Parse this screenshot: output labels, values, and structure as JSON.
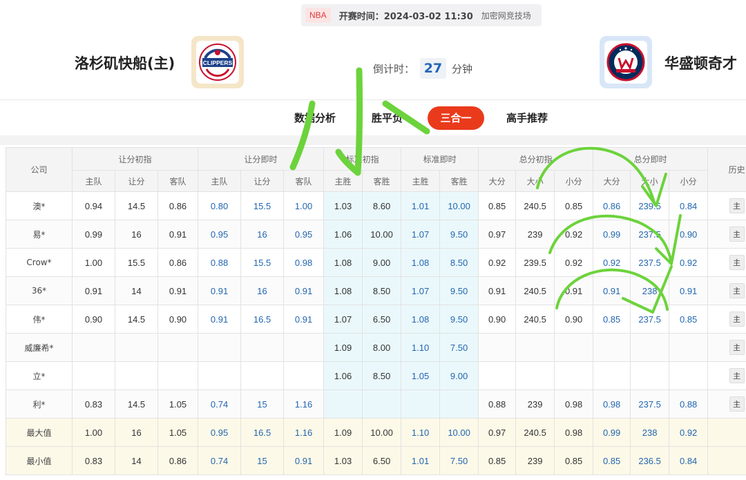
{
  "header": {
    "league": "NBA",
    "start_time": "开赛时间：2024-03-02 11:30",
    "venue": "加密网竞技场",
    "home_team": "洛杉矶快船(主)",
    "away_team": "华盛顿奇才",
    "home_logo_text": "CLIPPERS",
    "countdown_label": "倒计时：",
    "countdown_value": "27",
    "countdown_unit": "分钟"
  },
  "tabs": {
    "data": "数据分析",
    "spf": "胜平负",
    "three": "三合一",
    "expert": "高手推荐"
  },
  "table": {
    "company_header": "公司",
    "history_header": "历史",
    "groups": {
      "rf_init": "让分初指",
      "rf_live": "让分即时",
      "std_init": "标准初指",
      "std_live": "标准即时",
      "tot_init": "总分初指",
      "tot_live": "总分即时"
    },
    "sub": {
      "home": "主队",
      "handicap": "让分",
      "away": "客队",
      "home_win": "主胜",
      "away_win": "客胜",
      "over": "大分",
      "line": "大小",
      "under": "小分"
    },
    "history_btn": "主",
    "rows": [
      {
        "company": "澳*",
        "rf_init": [
          "0.94",
          "14.5",
          "0.86"
        ],
        "rf_live": [
          "0.80",
          "15.5",
          "1.00"
        ],
        "std_init": [
          "1.03",
          "8.60"
        ],
        "std_live": [
          "1.01",
          "10.00"
        ],
        "tot_init": [
          "0.85",
          "240.5",
          "0.85"
        ],
        "tot_live": [
          "0.86",
          "239.5",
          "0.84"
        ]
      },
      {
        "company": "易*",
        "rf_init": [
          "0.99",
          "16",
          "0.91"
        ],
        "rf_live": [
          "0.95",
          "16",
          "0.95"
        ],
        "std_init": [
          "1.06",
          "10.00"
        ],
        "std_live": [
          "1.07",
          "9.50"
        ],
        "tot_init": [
          "0.97",
          "239",
          "0.92"
        ],
        "tot_live": [
          "0.99",
          "237.5",
          "0.90"
        ]
      },
      {
        "company": "Crow*",
        "rf_init": [
          "1.00",
          "15.5",
          "0.86"
        ],
        "rf_live": [
          "0.88",
          "15.5",
          "0.98"
        ],
        "std_init": [
          "1.08",
          "9.00"
        ],
        "std_live": [
          "1.08",
          "8.50"
        ],
        "tot_init": [
          "0.92",
          "239.5",
          "0.92"
        ],
        "tot_live": [
          "0.92",
          "237.5",
          "0.92"
        ]
      },
      {
        "company": "36*",
        "rf_init": [
          "0.91",
          "14",
          "0.91"
        ],
        "rf_live": [
          "0.91",
          "16",
          "0.91"
        ],
        "std_init": [
          "1.08",
          "8.50"
        ],
        "std_live": [
          "1.07",
          "9.50"
        ],
        "tot_init": [
          "0.91",
          "240.5",
          "0.91"
        ],
        "tot_live": [
          "0.91",
          "238",
          "0.91"
        ]
      },
      {
        "company": "伟*",
        "rf_init": [
          "0.90",
          "14.5",
          "0.90"
        ],
        "rf_live": [
          "0.91",
          "16.5",
          "0.91"
        ],
        "std_init": [
          "1.07",
          "6.50"
        ],
        "std_live": [
          "1.08",
          "9.50"
        ],
        "tot_init": [
          "0.90",
          "240.5",
          "0.90"
        ],
        "tot_live": [
          "0.85",
          "237.5",
          "0.85"
        ]
      },
      {
        "company": "威廉希*",
        "rf_init": [
          "",
          "",
          ""
        ],
        "rf_live": [
          "",
          "",
          ""
        ],
        "std_init": [
          "1.09",
          "8.00"
        ],
        "std_live": [
          "1.10",
          "7.50"
        ],
        "tot_init": [
          "",
          "",
          ""
        ],
        "tot_live": [
          "",
          "",
          ""
        ]
      },
      {
        "company": "立*",
        "rf_init": [
          "",
          "",
          ""
        ],
        "rf_live": [
          "",
          "",
          ""
        ],
        "std_init": [
          "1.06",
          "8.50"
        ],
        "std_live": [
          "1.05",
          "9.00"
        ],
        "tot_init": [
          "",
          "",
          ""
        ],
        "tot_live": [
          "",
          "",
          ""
        ]
      },
      {
        "company": "利*",
        "rf_init": [
          "0.83",
          "14.5",
          "1.05"
        ],
        "rf_live": [
          "0.74",
          "15",
          "1.16"
        ],
        "std_init": [
          "",
          ""
        ],
        "std_live": [
          "",
          ""
        ],
        "tot_init": [
          "0.88",
          "239",
          "0.98"
        ],
        "tot_live": [
          "0.98",
          "237.5",
          "0.88"
        ]
      }
    ],
    "stats": [
      {
        "label": "最大值",
        "rf_init": [
          "1.00",
          "16",
          "1.05"
        ],
        "rf_live": [
          "0.95",
          "16.5",
          "1.16"
        ],
        "std_init": [
          "1.09",
          "10.00"
        ],
        "std_live": [
          "1.10",
          "10.00"
        ],
        "tot_init": [
          "0.97",
          "240.5",
          "0.98"
        ],
        "tot_live": [
          "0.99",
          "238",
          "0.92"
        ]
      },
      {
        "label": "最小值",
        "rf_init": [
          "0.83",
          "14",
          "0.86"
        ],
        "rf_live": [
          "0.74",
          "15",
          "0.91"
        ],
        "std_init": [
          "1.03",
          "6.50"
        ],
        "std_live": [
          "1.01",
          "7.50"
        ],
        "tot_init": [
          "0.85",
          "239",
          "0.85"
        ],
        "tot_live": [
          "0.85",
          "236.5",
          "0.84"
        ]
      }
    ]
  },
  "annotation": {
    "handwritten_text": "小",
    "color": "#6cd33c"
  },
  "colors": {
    "accent": "#ea3a1c",
    "live_value": "#2266b0",
    "standard_bg": "#eaf8fb",
    "stat_bg": "#fdf9e8"
  }
}
